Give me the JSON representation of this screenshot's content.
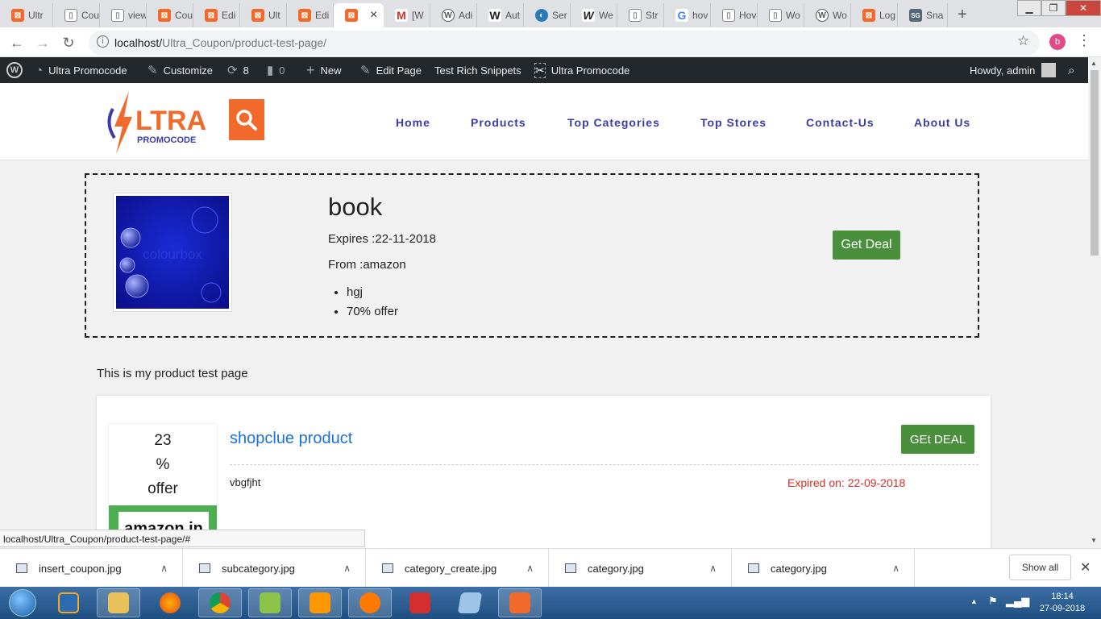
{
  "browser": {
    "tabs": [
      {
        "label": "Ultr",
        "icon": "xampp-icon",
        "color": "#f26a2b"
      },
      {
        "label": "Cou",
        "icon": "doc-icon",
        "color": "#888888"
      },
      {
        "label": "view",
        "icon": "doc-icon",
        "color": "#888888"
      },
      {
        "label": "Cou",
        "icon": "xampp-icon",
        "color": "#f26a2b"
      },
      {
        "label": "Edi",
        "icon": "xampp-icon",
        "color": "#f26a2b"
      },
      {
        "label": "Ult",
        "icon": "xampp-icon",
        "color": "#f26a2b"
      },
      {
        "label": "Edi",
        "icon": "xampp-icon",
        "color": "#f26a2b"
      },
      {
        "label": "",
        "icon": "xampp-icon",
        "color": "#f26a2b",
        "active": true
      },
      {
        "label": "[W",
        "icon": "gmail-icon",
        "color": "#d93025"
      },
      {
        "label": "Adi",
        "icon": "wordpress-icon",
        "color": "#555555"
      },
      {
        "label": "Aut",
        "icon": "w-icon",
        "color": "#333333"
      },
      {
        "label": "Ser",
        "icon": "globe-icon",
        "color": "#2a7ab8"
      },
      {
        "label": "We",
        "icon": "w-icon",
        "color": "#333333"
      },
      {
        "label": "Str",
        "icon": "doc-icon",
        "color": "#888888"
      },
      {
        "label": "hov",
        "icon": "google-icon",
        "color": "#4285f4"
      },
      {
        "label": "Hov",
        "icon": "doc-icon",
        "color": "#888888"
      },
      {
        "label": "Wo",
        "icon": "doc-icon",
        "color": "#888888"
      },
      {
        "label": "Wo",
        "icon": "wordpress-icon",
        "color": "#555555"
      },
      {
        "label": "Log",
        "icon": "xampp-icon",
        "color": "#f26a2b"
      },
      {
        "label": "Sna",
        "icon": "sg-icon",
        "color": "#556677"
      }
    ],
    "url_host": "localhost/",
    "url_path": "Ultra_Coupon/product-test-page/",
    "profile_initial": "b",
    "status_url": "localhost/Ultra_Coupon/product-test-page/#"
  },
  "admin_bar": {
    "site_name": "Ultra Promocode",
    "customize": "Customize",
    "updates": "8",
    "comments": "0",
    "new": "New",
    "edit_page": "Edit Page",
    "rich_snippets": "Test Rich Snippets",
    "plugin": "Ultra Promocode",
    "howdy": "Howdy, admin"
  },
  "site": {
    "logo_main": "LTRA",
    "logo_sub": "PROMOCODE",
    "nav": [
      "Home",
      "Products",
      "Top Categories",
      "Top Stores",
      "Contact-Us",
      "About Us"
    ],
    "accent_color": "#f26a2b",
    "nav_color": "#3c3ca8"
  },
  "product": {
    "title": "book",
    "expires": "Expires :22-11-2018",
    "from": "From :amazon",
    "features": [
      "hgj",
      "70% offer"
    ],
    "button": "Get Deal",
    "image_watermark": "colourbox"
  },
  "page_intro": "This is my product test page",
  "coupon": {
    "offer_value": "23",
    "offer_symbol": "%",
    "offer_word": "offer",
    "store": "amazon.in",
    "title": "shopclue product",
    "description": "vbgfjht",
    "expired": "Expired on: 22-09-2018",
    "button": "GEt DEAL"
  },
  "downloads": {
    "items": [
      "insert_coupon.jpg",
      "subcategory.jpg",
      "category_create.jpg",
      "category.jpg",
      "category.jpg"
    ],
    "show_all": "Show all"
  },
  "taskbar": {
    "time": "18:14",
    "date": "27-09-2018"
  }
}
